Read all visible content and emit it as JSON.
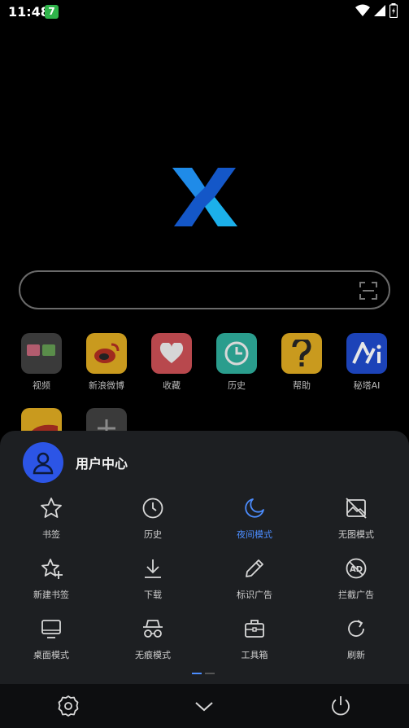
{
  "status_bar": {
    "time": "11:48",
    "badge": "7"
  },
  "shortcuts": [
    {
      "label": "视频"
    },
    {
      "label": "新浪微博"
    },
    {
      "label": "收藏"
    },
    {
      "label": "历史"
    },
    {
      "label": "帮助"
    },
    {
      "label": "秘塔AI"
    }
  ],
  "sheet": {
    "user_title": "用户中心",
    "menu": [
      {
        "label": "书签",
        "icon": "star-icon"
      },
      {
        "label": "历史",
        "icon": "clock-icon"
      },
      {
        "label": "夜间模式",
        "icon": "moon-icon",
        "active": true
      },
      {
        "label": "无图模式",
        "icon": "no-image-icon"
      },
      {
        "label": "新建书签",
        "icon": "star-plus-icon"
      },
      {
        "label": "下载",
        "icon": "download-icon"
      },
      {
        "label": "标识广告",
        "icon": "pencil-icon"
      },
      {
        "label": "拦截广告",
        "icon": "ad-block-icon"
      },
      {
        "label": "桌面模式",
        "icon": "desktop-icon"
      },
      {
        "label": "无痕模式",
        "icon": "incognito-icon"
      },
      {
        "label": "工具箱",
        "icon": "toolbox-icon"
      },
      {
        "label": "刷新",
        "icon": "refresh-icon"
      }
    ]
  },
  "colors": {
    "accent": "#4c8dff",
    "sheet_bg": "#1d1f22",
    "avatar": "#2c55e6"
  }
}
